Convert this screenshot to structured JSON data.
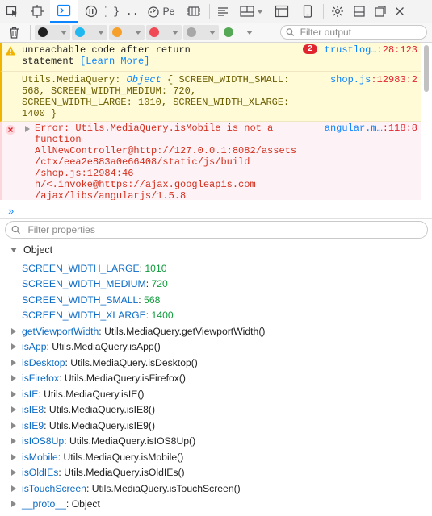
{
  "toolbar": {
    "items": [
      {
        "name": "pick-element-icon"
      },
      {
        "name": "inspector-icon"
      },
      {
        "name": "console-icon",
        "selected": true
      },
      {
        "name": "debugger-icon"
      },
      {
        "name": "style-editor-icon",
        "label": "{ } ..."
      },
      {
        "name": "performance-icon",
        "label": "Pe"
      },
      {
        "name": "memory-icon"
      }
    ],
    "right_icons": [
      "options-icon",
      "split-console-icon",
      "responsive-mode-icon",
      "settings-icon",
      "dock-icon",
      "undock-icon",
      "close-icon"
    ]
  },
  "filterbar": {
    "swatches": [
      {
        "name": "errors-filter",
        "color": "#1f1f1f"
      },
      {
        "name": "warnings-filter",
        "color": "#20b8f0"
      },
      {
        "name": "logs-filter",
        "color": "#f6a02b"
      },
      {
        "name": "css-filter",
        "color": "#ef4a55"
      },
      {
        "name": "js-filter",
        "color": "#a8a8a8"
      },
      {
        "name": "net-filter",
        "color": "#55a855"
      }
    ],
    "search_placeholder": "Filter output"
  },
  "console": {
    "warning": {
      "line1": "unreachable code after return",
      "line2_prefix": "statement ",
      "learn_more": "[Learn More]",
      "badge": "2",
      "source": "trustlog…",
      "source_line": ":28:123"
    },
    "log": {
      "lines": [
        "Utils.MediaQuery: Object { SCREEN_WIDTH_SMALL:",
        "568, SCREEN_WIDTH_MEDIUM: 720,",
        "SCREEN_WIDTH_LARGE: 1010, SCREEN_WIDTH_XLARGE:",
        "1400 }"
      ],
      "source": "shop.js",
      "source_line": ":12983:2"
    },
    "error": {
      "lines": [
        "Error: Utils.MediaQuery.isMobile is not a",
        "function",
        "AllNewController@http://127.0.0.1:8082/assets",
        "/ctx/eea2e883a0e66408/static/js/build",
        "/shop.js:12984:46",
        "h/<.invoke@https://ajax.googleapis.com",
        "/ajax/libs/angularjs/1.5.8"
      ],
      "source": "angular.m…",
      "source_line": ":118:8"
    }
  },
  "prompt": {
    "symbol": "»"
  },
  "properties": {
    "search_placeholder": "Filter properties",
    "header": "Object",
    "constants": [
      {
        "key": "SCREEN_WIDTH_LARGE",
        "value": "1010"
      },
      {
        "key": "SCREEN_WIDTH_MEDIUM",
        "value": "720"
      },
      {
        "key": "SCREEN_WIDTH_SMALL",
        "value": "568"
      },
      {
        "key": "SCREEN_WIDTH_XLARGE",
        "value": "1400"
      }
    ],
    "methods": [
      {
        "key": "getViewportWidth",
        "value": "Utils.MediaQuery.getViewportWidth()"
      },
      {
        "key": "isApp",
        "value": "Utils.MediaQuery.isApp()"
      },
      {
        "key": "isDesktop",
        "value": "Utils.MediaQuery.isDesktop()"
      },
      {
        "key": "isFirefox",
        "value": "Utils.MediaQuery.isFirefox()"
      },
      {
        "key": "isIE",
        "value": "Utils.MediaQuery.isIE()"
      },
      {
        "key": "isIE8",
        "value": "Utils.MediaQuery.isIE8()"
      },
      {
        "key": "isIE9",
        "value": "Utils.MediaQuery.isIE9()"
      },
      {
        "key": "isIOS8Up",
        "value": "Utils.MediaQuery.isIOS8Up()"
      },
      {
        "key": "isMobile",
        "value": "Utils.MediaQuery.isMobile()"
      },
      {
        "key": "isOldIEs",
        "value": "Utils.MediaQuery.isOldIEs()"
      },
      {
        "key": "isTouchScreen",
        "value": "Utils.MediaQuery.isTouchScreen()"
      },
      {
        "key": "__proto__",
        "value": "Object"
      }
    ]
  }
}
